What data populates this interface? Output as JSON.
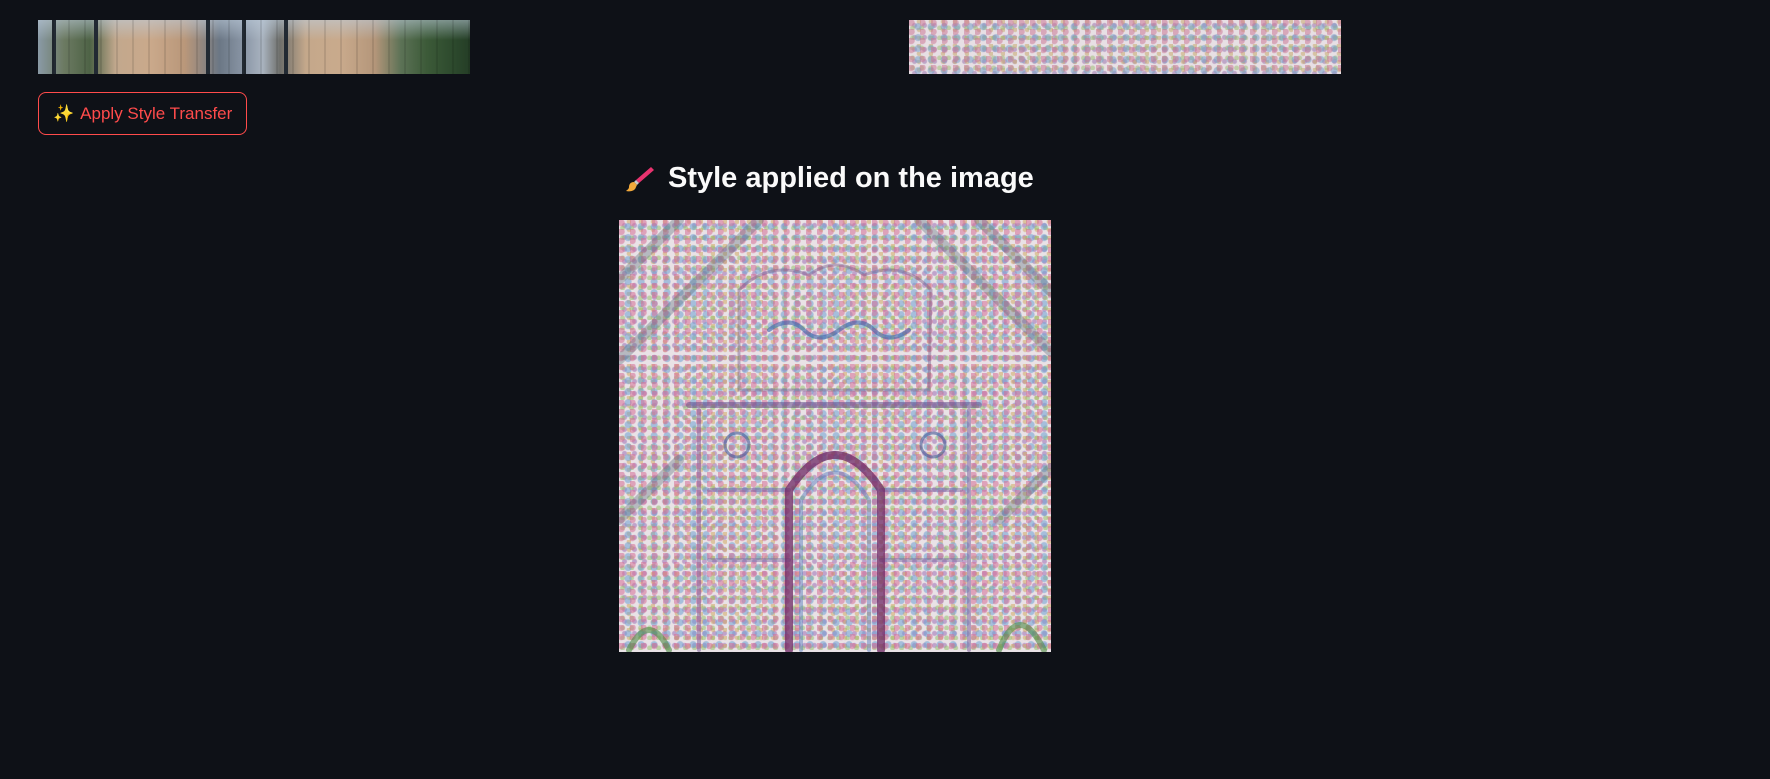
{
  "content_image": {
    "icon": "photo-strip"
  },
  "style_image": {
    "icon": "texture-strip"
  },
  "apply_button": {
    "icon": "sparkles",
    "label": "Apply Style Transfer",
    "color": "#ff4b4b"
  },
  "result": {
    "heading_icon": "paintbrush",
    "heading": "Style applied on the image"
  },
  "theme": {
    "background": "#0e1117",
    "text": "#fafafa",
    "accent": "#ff4b4b"
  }
}
